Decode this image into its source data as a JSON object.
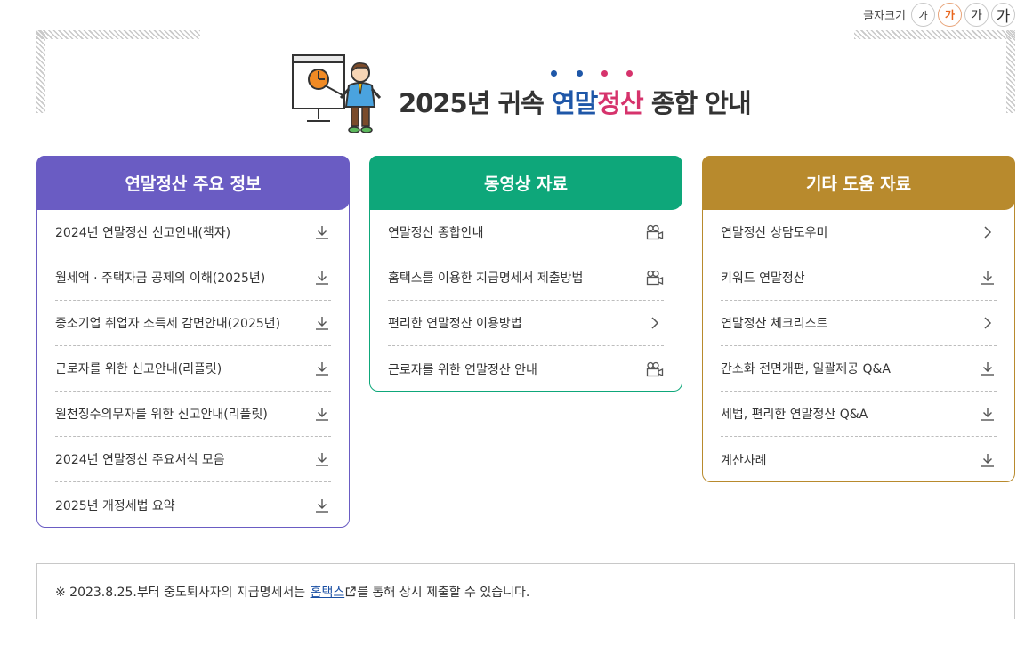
{
  "font_size": {
    "label": "글자크기",
    "options": [
      "가",
      "가",
      "가",
      "가"
    ]
  },
  "header": {
    "year_title": "2025년 귀속",
    "highlight_1": "연말",
    "highlight_2": "정산",
    "suffix": "종합 안내",
    "illustration": "presenter-with-chart-icon",
    "dot_colors": [
      "#1f57a8",
      "#1f57a8",
      "#d6336c",
      "#d6336c"
    ]
  },
  "panels": [
    {
      "title": "연말정산 주요 정보",
      "color": "#6a5cc3",
      "items": [
        {
          "label": "2024년 연말정산 신고안내(책자)",
          "icon": "download-icon"
        },
        {
          "label": "월세액 · 주택자금 공제의 이해(2025년)",
          "icon": "download-icon"
        },
        {
          "label": "중소기업 취업자 소득세 감면안내(2025년)",
          "icon": "download-icon"
        },
        {
          "label": "근로자를 위한 신고안내(리플릿)",
          "icon": "download-icon"
        },
        {
          "label": "원천징수의무자를 위한 신고안내(리플릿)",
          "icon": "download-icon"
        },
        {
          "label": "2024년 연말정산 주요서식 모음",
          "icon": "download-icon"
        },
        {
          "label": "2025년 개정세법 요약",
          "icon": "download-icon"
        }
      ]
    },
    {
      "title": "동영상 자료",
      "color": "#0ea77a",
      "items": [
        {
          "label": "연말정산 종합안내",
          "icon": "video-camera-icon"
        },
        {
          "label": "홈택스를 이용한 지급명세서 제출방법",
          "icon": "video-camera-icon"
        },
        {
          "label": "편리한 연말정산 이용방법",
          "icon": "chevron-right-icon"
        },
        {
          "label": "근로자를 위한 연말정산 안내",
          "icon": "video-camera-icon"
        }
      ]
    },
    {
      "title": "기타 도움 자료",
      "color": "#b88a2d",
      "items": [
        {
          "label": "연말정산 상담도우미",
          "icon": "chevron-right-icon"
        },
        {
          "label": "키워드 연말정산",
          "icon": "download-icon"
        },
        {
          "label": "연말정산 체크리스트",
          "icon": "chevron-right-icon"
        },
        {
          "label": "간소화 전면개편, 일괄제공 Q&A",
          "icon": "download-icon"
        },
        {
          "label": "세법, 편리한 연말정산 Q&A",
          "icon": "download-icon"
        },
        {
          "label": "계산사례",
          "icon": "download-icon"
        }
      ]
    }
  ],
  "notice": {
    "prefix": "※ 2023.8.25.부터 중도퇴사자의 지급명세서는",
    "link": "홈택스",
    "link_icon": "external-link-icon",
    "suffix": "를 통해 상시 제출할 수 있습니다."
  }
}
